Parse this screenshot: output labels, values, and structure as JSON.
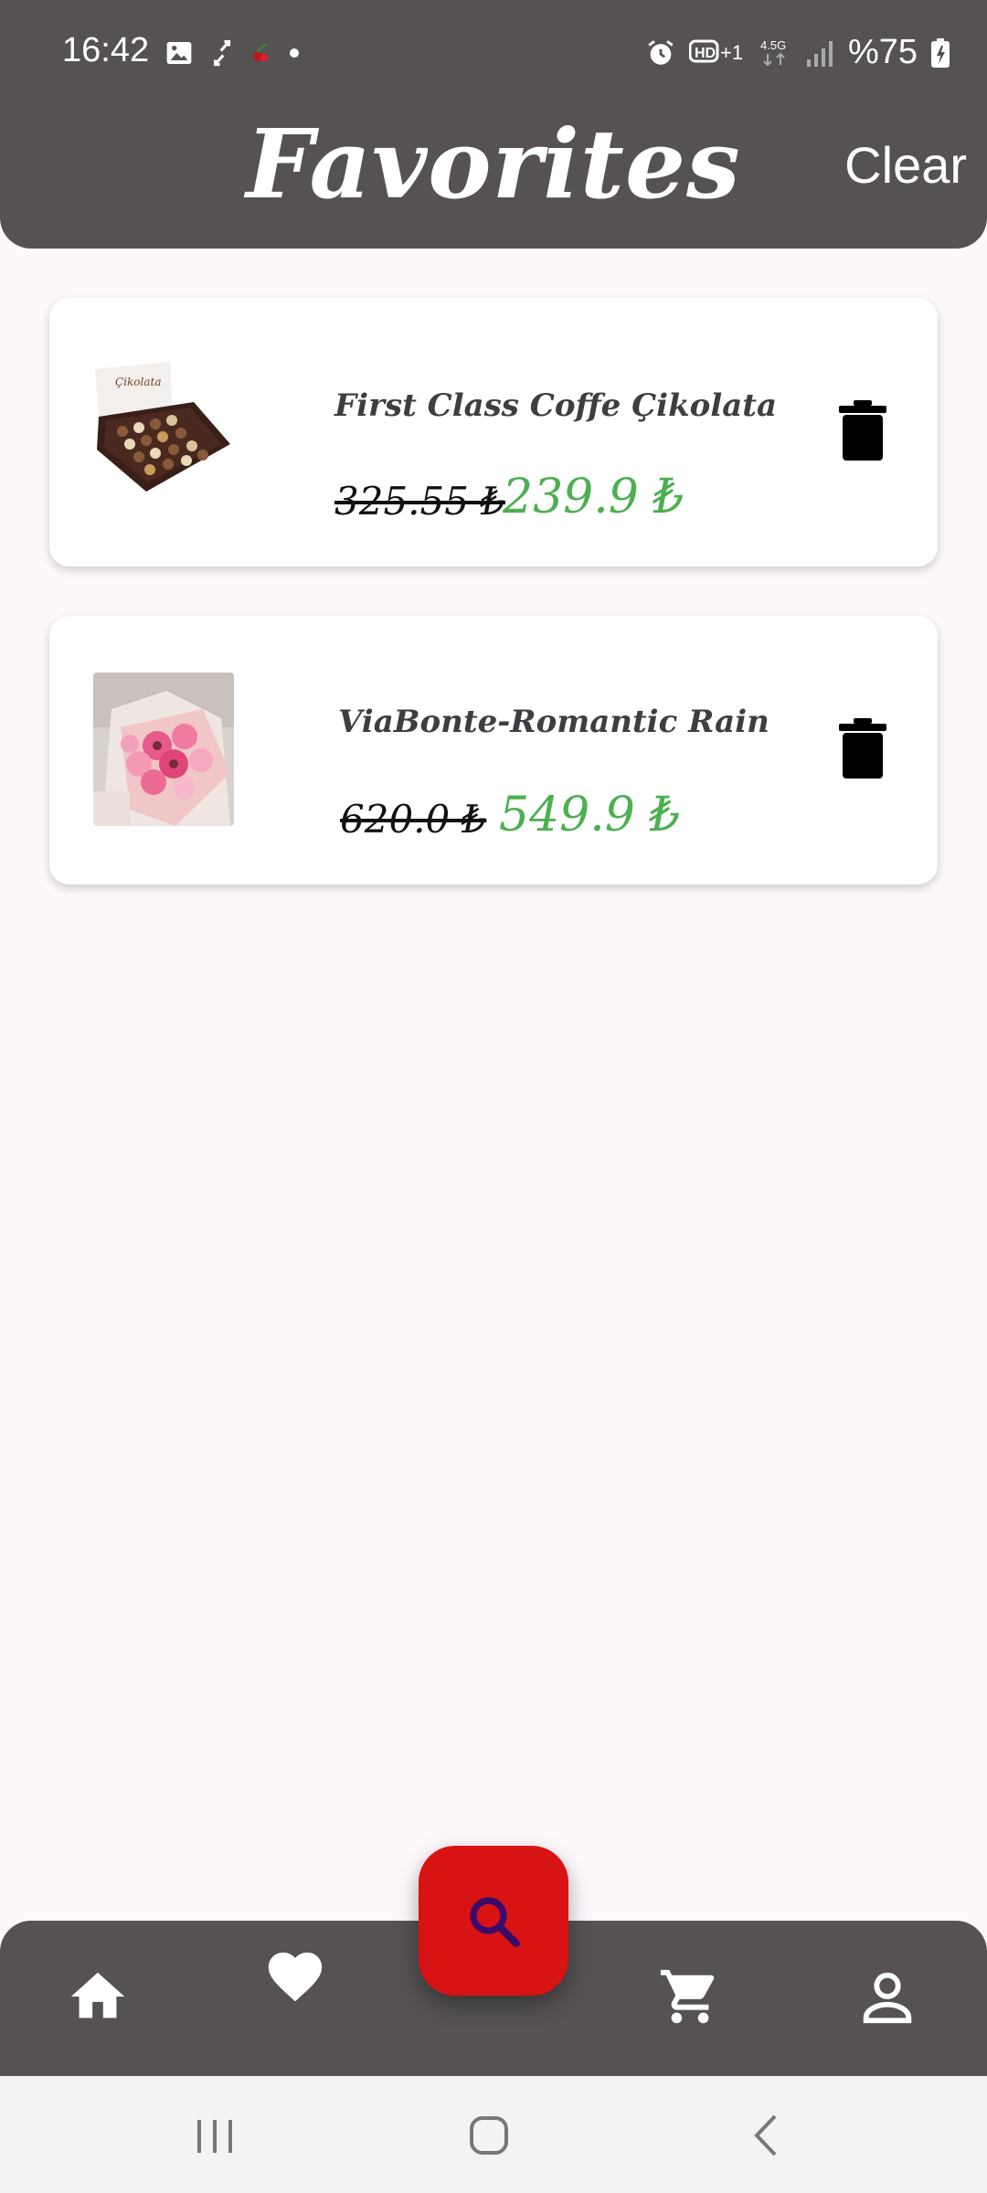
{
  "status_bar": {
    "time": "16:42",
    "battery_text": "%75",
    "icons": [
      "gallery-icon",
      "sync-icon",
      "cherry-icon",
      "dot-icon",
      "alarm-icon",
      "hd-volte-icon",
      "data-4-5g-icon",
      "signal-icon",
      "battery-charging-icon"
    ]
  },
  "header": {
    "title": "Favorites",
    "clear_label": "Clear"
  },
  "favorites": [
    {
      "name": "First Class Coffe Çikolata",
      "old_price": "325.55 ₺",
      "new_price": "239.9 ₺",
      "image_icon": "chocolate-box-image"
    },
    {
      "name": "ViaBonte-Romantic Rain",
      "old_price": "620.0 ₺",
      "new_price": "549.9 ₺",
      "image_icon": "flower-bouquet-image"
    }
  ],
  "colors": {
    "header_bg": "#565253",
    "page_bg": "#fdf8fb",
    "price_green": "#4caf50",
    "fab_red": "#d81313",
    "fab_icon": "#3a0b6b"
  },
  "bottom_nav": {
    "items": [
      "home-icon",
      "heart-icon",
      "search-icon",
      "cart-icon",
      "person-icon"
    ]
  },
  "system_nav": {
    "items": [
      "recents-icon",
      "home-circle-icon",
      "back-icon"
    ]
  }
}
